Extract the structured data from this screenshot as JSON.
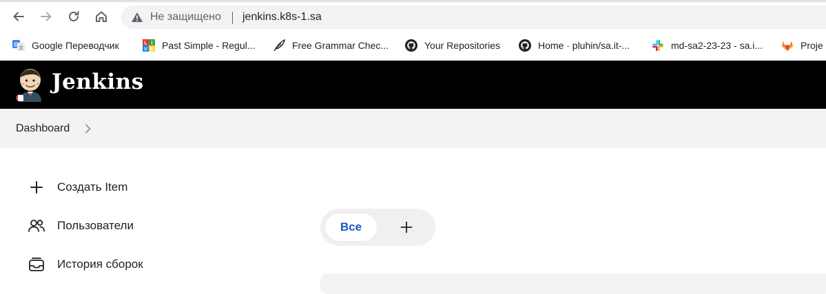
{
  "browser": {
    "security_label": "Не защищено",
    "url": "jenkins.k8s-1.sa"
  },
  "bookmarks": [
    {
      "label": "Google Переводчик",
      "icon": "google-translate-icon"
    },
    {
      "label": "Past Simple - Regul...",
      "icon": "live-icon"
    },
    {
      "label": "Free Grammar Chec...",
      "icon": "feather-icon"
    },
    {
      "label": "Your Repositories",
      "icon": "github-icon"
    },
    {
      "label": "Home · pluhin/sa.it-...",
      "icon": "github-icon"
    },
    {
      "label": "md-sa2-23-23 - sa.i...",
      "icon": "slack-icon"
    },
    {
      "label": "Proje",
      "icon": "gitlab-icon"
    }
  ],
  "header": {
    "title": "Jenkins"
  },
  "breadcrumb": {
    "items": [
      "Dashboard"
    ]
  },
  "sidebar": {
    "items": [
      {
        "label": "Создать Item",
        "icon": "plus-icon"
      },
      {
        "label": "Пользователи",
        "icon": "users-icon"
      },
      {
        "label": "История сборок",
        "icon": "inbox-icon"
      }
    ]
  },
  "views": {
    "tabs": [
      {
        "label": "Все",
        "active": true
      }
    ],
    "add_icon": "plus-icon"
  },
  "colors": {
    "header_bg": "#000000",
    "active_tab_text": "#1a56c4",
    "breadcrumb_bg": "#f3f3f5"
  }
}
